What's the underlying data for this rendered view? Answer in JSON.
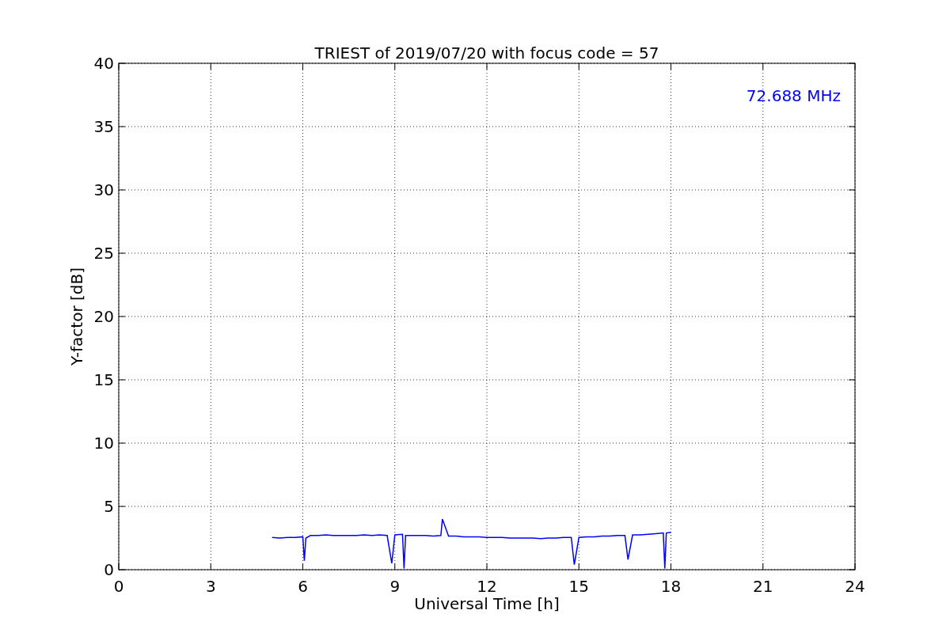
{
  "chart_data": {
    "type": "line",
    "title": "TRIEST of 2019/07/20 with focus code = 57",
    "xlabel": "Universal Time [h]",
    "ylabel": "Y-factor [dB]",
    "xlim": [
      0,
      24
    ],
    "ylim": [
      0,
      40
    ],
    "xticks": [
      0,
      3,
      6,
      9,
      12,
      15,
      18,
      21,
      24
    ],
    "yticks": [
      0,
      5,
      10,
      15,
      20,
      25,
      30,
      35,
      40
    ],
    "x": [
      5,
      5.25,
      5.5,
      5.75,
      6,
      6.05,
      6.1,
      6.25,
      6.5,
      6.75,
      7,
      7.25,
      7.5,
      7.75,
      8,
      8.25,
      8.5,
      8.75,
      8.9,
      9,
      9.25,
      9.3,
      9.35,
      9.5,
      9.75,
      10,
      10.25,
      10.5,
      10.55,
      10.75,
      11,
      11.25,
      11.5,
      11.75,
      12,
      12.25,
      12.5,
      12.75,
      13,
      13.25,
      13.5,
      13.75,
      14,
      14.25,
      14.5,
      14.75,
      14.85,
      15,
      15.25,
      15.5,
      15.75,
      16,
      16.25,
      16.5,
      16.6,
      16.75,
      17,
      17.25,
      17.5,
      17.75,
      17.8,
      17.85,
      18
    ],
    "series": [
      {
        "name": "72.688 MHz",
        "color": "#0000ff",
        "values": [
          2.55,
          2.5,
          2.55,
          2.55,
          2.6,
          0.7,
          2.5,
          2.7,
          2.7,
          2.75,
          2.7,
          2.7,
          2.7,
          2.7,
          2.75,
          2.7,
          2.75,
          2.7,
          0.5,
          2.75,
          2.8,
          0.1,
          2.7,
          2.7,
          2.7,
          2.7,
          2.65,
          2.7,
          4.0,
          2.65,
          2.65,
          2.6,
          2.6,
          2.6,
          2.55,
          2.55,
          2.55,
          2.5,
          2.5,
          2.5,
          2.5,
          2.45,
          2.5,
          2.5,
          2.55,
          2.55,
          0.4,
          2.55,
          2.6,
          2.6,
          2.65,
          2.65,
          2.7,
          2.7,
          0.8,
          2.75,
          2.75,
          2.8,
          2.85,
          2.9,
          0.1,
          2.9,
          2.95
        ]
      }
    ],
    "grid": true
  }
}
